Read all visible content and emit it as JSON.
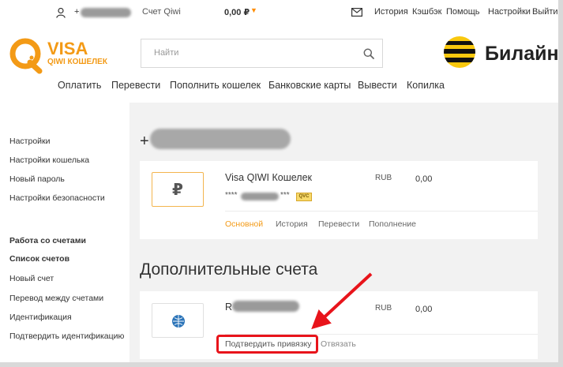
{
  "topbar": {
    "phone_prefix": "+",
    "account_label": "Счет Qiwi",
    "balance": "0,00 ₽",
    "links": [
      {
        "name": "history-link",
        "label": "История"
      },
      {
        "name": "cashback-link",
        "label": "Кэшбэк"
      },
      {
        "name": "help-link",
        "label": "Помощь"
      },
      {
        "name": "settings-link",
        "label": "Настройки"
      },
      {
        "name": "logout-link",
        "label": "Выйти"
      }
    ]
  },
  "logo": {
    "visa": "VISA",
    "qiwi": "QIWI КОШЕЛЕК"
  },
  "search": {
    "placeholder": "Найти"
  },
  "partner": {
    "name": "Билайн"
  },
  "mainnav": [
    "Оплатить",
    "Перевести",
    "Пополнить кошелек",
    "Банковские карты",
    "Вывести",
    "Копилка"
  ],
  "sidebar": {
    "items": [
      "Настройки",
      "Настройки кошелька",
      "Новый пароль",
      "Настройки безопасности"
    ],
    "section_title": "Работа со счетами",
    "section_items": [
      "Список счетов",
      "Новый счет",
      "Перевод между счетами",
      "Идентификация",
      "Подтвердить идентификацию"
    ]
  },
  "main": {
    "phone_prefix": "+",
    "primary_account": {
      "badge": "₽",
      "name": "Visa QIWI Кошелек",
      "currency": "RUB",
      "amount": "0,00",
      "number_prefix": "****",
      "number_suffix": "***",
      "badge_qvc": "QVC",
      "actions": [
        "Основной",
        "История",
        "Перевести",
        "Пополнение"
      ]
    },
    "additional_title": "Дополнительные счета",
    "additional_account": {
      "name_prefix": "R",
      "currency": "RUB",
      "amount": "0,00",
      "confirm_action": "Подтвердить привязку",
      "unlink_action": "Отвязать"
    }
  },
  "colors": {
    "accent": "#f39a16",
    "highlight": "#e8141b",
    "content_bg": "#f2f2f2"
  }
}
